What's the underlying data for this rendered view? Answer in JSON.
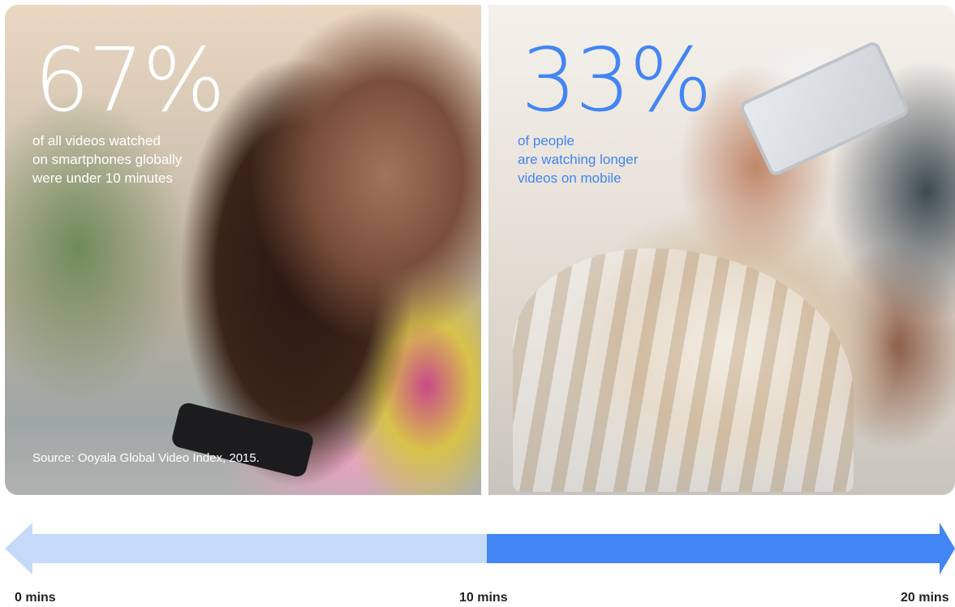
{
  "left_panel": {
    "stat": "67%",
    "description": [
      "of all videos watched",
      "on smartphones globally",
      "were under 10 minutes"
    ],
    "source": "Source: Ooyala Global Video Index, 2015."
  },
  "right_panel": {
    "stat": "33%",
    "description": [
      "of people",
      "are watching longer",
      "videos on mobile"
    ]
  },
  "timeline": {
    "ticks": [
      "0 mins",
      "10 mins",
      "20 mins"
    ]
  },
  "colors": {
    "accent_blue": "#4285f4",
    "light_blue": "#c5daf9",
    "label_dark": "#202124"
  },
  "images": {
    "left": "woman-smiling-at-smartphone-photo",
    "right": "man-lying-holding-smartphone-photo"
  }
}
